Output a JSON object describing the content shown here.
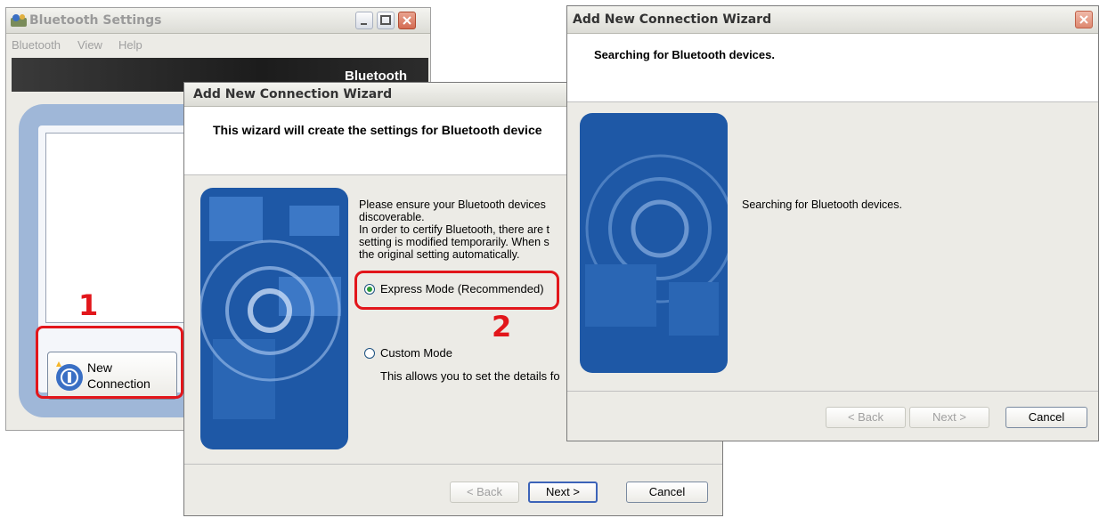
{
  "bt_window": {
    "title": "Bluetooth Settings",
    "menu": [
      "Bluetooth",
      "View",
      "Help"
    ],
    "banner_logo": "Bluetooth",
    "new_connection_label": "New\nConnection",
    "icons": [
      "bluetooth-app-icon",
      "new-connection-icon"
    ]
  },
  "wizard1": {
    "title": "Add New Connection Wizard",
    "header": "This wizard will create the settings for Bluetooth device",
    "intro_lines": [
      "Please ensure your Bluetooth devices",
      "discoverable.",
      "In order to certify Bluetooth, there are t",
      "setting is modified temporarily. When s",
      "the original setting automatically."
    ],
    "express_mode": "Express Mode (Recommended)",
    "custom_mode": "Custom Mode",
    "custom_desc": "This allows you to set the details fo",
    "selected_mode": "Express Mode (Recommended)",
    "buttons": {
      "back": "< Back",
      "next": "Next >",
      "cancel": "Cancel"
    }
  },
  "wizard2": {
    "title": "Add New Connection Wizard",
    "header": "Searching for Bluetooth devices.",
    "status": "Searching for Bluetooth devices.",
    "buttons": {
      "back": "< Back",
      "next": "Next >",
      "cancel": "Cancel"
    }
  },
  "annotations": {
    "step1": "1",
    "step2": "2"
  },
  "colors": {
    "highlight": "#e2161b",
    "panel_blue": "#1e58a6",
    "frame_blue": "#9fb7d8"
  }
}
